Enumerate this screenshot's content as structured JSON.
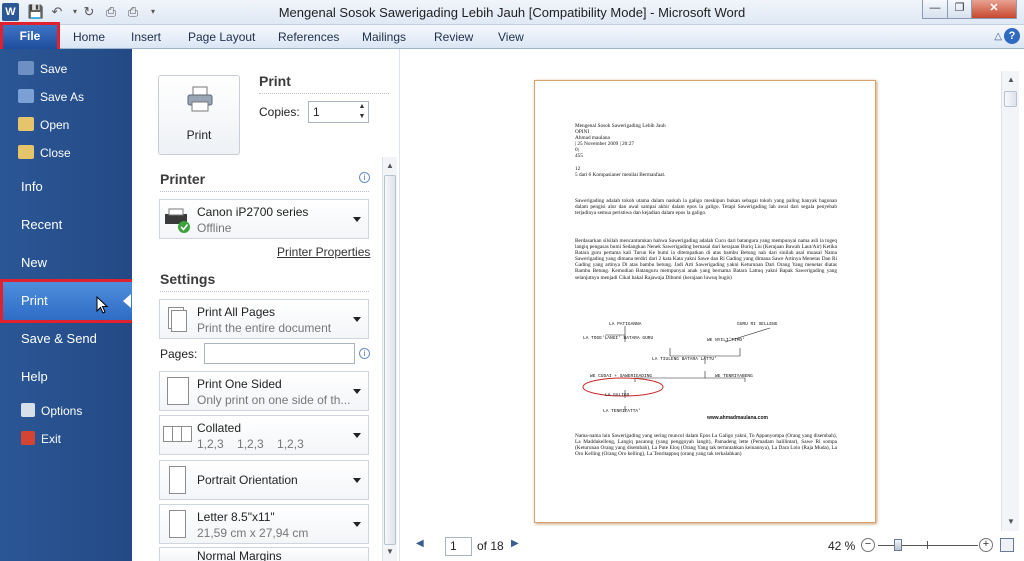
{
  "window": {
    "title": "Mengenal Sosok Sawerigading Lebih Jauh [Compatibility Mode]  -  Microsoft Word",
    "app_icon": "W",
    "controls": [
      "minimize-icon",
      "restore-icon",
      "close-icon"
    ]
  },
  "ribbon": {
    "tabs": [
      "File",
      "Home",
      "Insert",
      "Page Layout",
      "References",
      "Mailings",
      "Review",
      "View"
    ]
  },
  "backstage_nav": {
    "small_items": [
      {
        "label": "Save",
        "icon": "save-icon"
      },
      {
        "label": "Save As",
        "icon": "save-as-icon"
      },
      {
        "label": "Open",
        "icon": "open-folder-icon"
      },
      {
        "label": "Close",
        "icon": "close-folder-icon"
      }
    ],
    "big_items": [
      "Info",
      "Recent",
      "New",
      "Print",
      "Save & Send",
      "Help"
    ],
    "footer_items": [
      {
        "label": "Options",
        "icon": "options-icon"
      },
      {
        "label": "Exit",
        "icon": "exit-icon"
      }
    ],
    "selected": "Print"
  },
  "print_panel": {
    "print_button": "Print",
    "section_title": "Print",
    "copies_label": "Copies:",
    "copies_value": "1",
    "printer_heading": "Printer",
    "printer_name": "Canon iP2700 series",
    "printer_status": "Offline",
    "printer_properties": "Printer Properties",
    "settings_heading": "Settings",
    "pages_label": "Pages:",
    "pages_value": "",
    "settings": [
      {
        "title": "Print All Pages",
        "subtitle": "Print the entire document"
      },
      {
        "title": "Print One Sided",
        "subtitle": "Only print on one side of th..."
      },
      {
        "title": "Collated",
        "subtitle": "1,2,3    1,2,3    1,2,3"
      },
      {
        "title": "Portrait Orientation",
        "subtitle": ""
      },
      {
        "title": "Letter 8.5\"x11\"",
        "subtitle": "21,59 cm x 27,94 cm"
      },
      {
        "title": "Normal Margins",
        "subtitle": ""
      }
    ]
  },
  "preview": {
    "current_page": "1",
    "total_pages": "of 18",
    "zoom": "42 %",
    "doc": {
      "header": "Mengenal Sosok Sawerigading Lebih Jauh\nOPINI\nAhmad maulana\n| 25 November 2009 | 20:27\n0|\n455\n\n12\n5 dari 6 Kompasianer menilai Bermanfaat.",
      "para1": "Sawerigading adalah tokoh utama dalam naskah la galigo meskipun bukan sebagai tokoh yang paling banyak bagonan dalam pengisi alur dan awal sampai akhir dalam epos la galigo. Tetapi Sawerigading lah awal dari segala penyebab terjadinya semua peristiwa dan kejadian dalam epos la galigo.",
      "para2": "Berdasarkan silsilah mencantumkan bahwa Sawerigading adalah Cucu dari batangura yang mempunyai nama asli la togeq langiq pengasas bumi Sedangkan Nenek Sawerigading bernasal dari kerajaan Buriq Liu (Kerajaan Bawah Laut/Air) Ketika Batara guru pertama kali Turun Ke bumi ia ditempatkan di atas bambu Betung nah dari sinilah asal muasal Nama Sawerigading yang dimana terdiri dari 2 kata Kata yakni Sawe dan Ri Gading yang dimana Sawe Artinya Menetas Dan Ri Gading yang artinya Di atas bambu betung. Jadi Arti Sawerigading yakni Keturunan Dari Orang Yang menetas diatas Bambu Betung. Kemudian Batanguru mempunyai anak yang bernama Batara Lattuq yakni Bapak Sawerigading yang selanjutnya menjadi Cikal bakal Rajawaja Dibumi (kerajaan luwuq bugis)",
      "diagram": {
        "la_patiganna": "LA PATIGANNA",
        "la_togelangi": "LA TOGE'LANGI' BATARA GURU",
        "guru_ri_selleng": "GURU RI SELLENG",
        "we_nyili": "WE NYILI'TIMO'",
        "la_tiuleng": "LA TIULENG BATARA LATTU'",
        "we_cudai": "WE CUDAI  +  SAWERIGADING",
        "we_tenriyabeng": "WE TENRIYABENG",
        "la_galigo": "LA GALIGO",
        "la_tenritatta": "LA TENRITATTA'",
        "watermark": "www.ahmadmaulana.com"
      },
      "para3": "Nama-nama lain Sawerigading yang sering muncul dalam Epos La Galigo yakni, To Appanyompa (Orang yang disembah), La Maddukelleng, Langiq pacanng (yang penggoyah langit), Pamadeng lette (Pemadam halilintar), Sawe Ri sompa (Keturunan Orang yang disembah), La Pute Eloq (Orang Yang tak tertuntahkan keinannya), La Dara Lolo (Raja Muda), La Oro Kelling (Orang Oro kelling), La Tenritappuq (orang yang tak terkalahkan)"
    }
  }
}
